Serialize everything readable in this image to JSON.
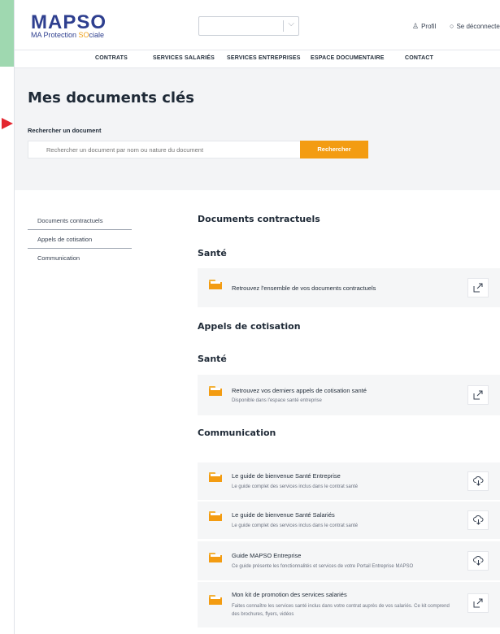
{
  "header": {
    "logo_main": "MAPSO",
    "logo_sub_pre": "MA Protection ",
    "logo_sub_hl": "SO",
    "logo_sub_post": "ciale",
    "profile_label": "Profil",
    "logout_label": "Se déconnecter"
  },
  "nav": {
    "items": [
      "CONTRATS",
      "SERVICES SALARIÉS",
      "SERVICES ENTREPRISES",
      "ESPACE DOCUMENTAIRE",
      "CONTACT"
    ]
  },
  "hero": {
    "title": "Mes documents clés",
    "search_label": "Rechercher un document",
    "search_placeholder": "Rechercher un document par nom ou nature du document",
    "search_button": "Rechercher"
  },
  "sidebar": {
    "items": [
      "Documents contractuels",
      "Appels de cotisation",
      "Communication"
    ]
  },
  "sections": {
    "contractuels": "Documents contractuels",
    "contractuels_sante": "Santé",
    "cotisation": "Appels de cotisation",
    "cotisation_sante": "Santé",
    "communication": "Communication"
  },
  "cards": [
    {
      "title": "Retrouvez l'ensemble de vos documents contractuels",
      "desc": "",
      "action": "external-link-icon"
    },
    {
      "title": "Retrouvez vos derniers appels de cotisation santé",
      "desc": "Disponible dans l'espace santé entreprise",
      "action": "external-link-icon"
    },
    {
      "title": "Le guide de bienvenue Santé Entreprise",
      "desc": "Le guide complet des services inclus dans le contrat santé",
      "action": "download-cloud-icon"
    },
    {
      "title": "Le guide de bienvenue Santé Salariés",
      "desc": "Le guide complet des services inclus dans le contrat santé",
      "action": "download-cloud-icon"
    },
    {
      "title": "Guide MAPSO Entreprise",
      "desc": "Ce guide présente les fonctionnalités et services de votre Portail Entreprise MAPSO",
      "action": "download-cloud-icon"
    },
    {
      "title": "Mon kit de promotion des services salariés",
      "desc": "Faites connaître les services santé inclus dans votre contrat auprès de vos salariés. Ce kit comprend des brochures, flyers, vidéos",
      "action": "external-link-icon"
    }
  ],
  "colors": {
    "brand_blue": "#2e3f8f",
    "accent_orange": "#f39c12",
    "backdrop_green": "#9fd8b0"
  }
}
